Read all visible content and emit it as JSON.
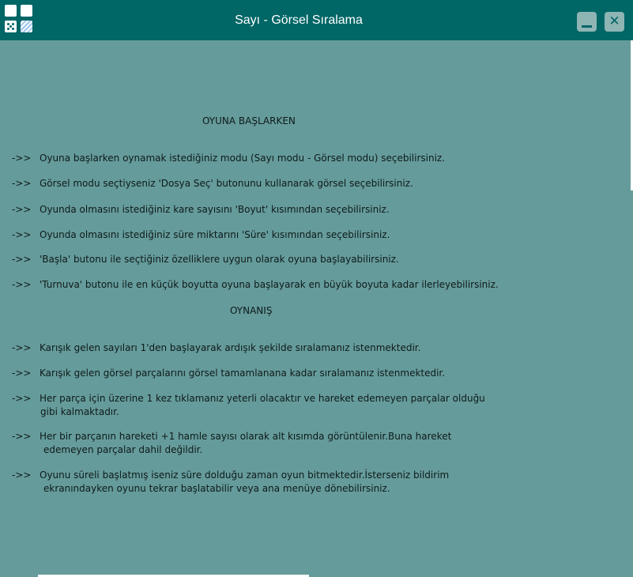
{
  "window": {
    "title": "Sayı - Görsel Sıralama",
    "icons": {
      "app": "grid-dice-icon",
      "minimize": "minimize-icon",
      "close": "close-icon"
    },
    "colors": {
      "titlebar": "#006666",
      "background": "#669b9b"
    }
  },
  "sections": [
    {
      "heading": "OYUNA BAŞLARKEN",
      "items": [
        {
          "arrow": "->>",
          "text": "Oyuna başlarken oynamak istediğiniz modu (Sayı modu - Görsel modu) seçebilirsiniz."
        },
        {
          "arrow": "->>",
          "text": "Görsel modu seçtiyseniz 'Dosya Seç' butonunu kullanarak görsel seçebilirsiniz."
        },
        {
          "arrow": "->>",
          "text": "Oyunda olmasını istediğiniz kare sayısını 'Boyut' kısımından seçebilirsiniz."
        },
        {
          "arrow": "->>",
          "text": "Oyunda olmasını istediğiniz süre miktarını 'Süre' kısımından seçebilirsiniz."
        },
        {
          "arrow": "->>",
          "text": "'Başla' butonu ile seçtiğiniz özelliklere uygun olarak oyuna başlayabilirsiniz."
        },
        {
          "arrow": "->>",
          "text": "'Turnuva' butonu ile en küçük boyutta oyuna başlayarak en büyük boyuta kadar ilerleyebilirsiniz."
        }
      ]
    },
    {
      "heading": "OYNANIŞ",
      "items": [
        {
          "arrow": "->>",
          "text": "Karışık gelen sayıları 1'den başlayarak ardışık şekilde sıralamanız istenmektedir."
        },
        {
          "arrow": "->>",
          "text": "Karışık gelen görsel parçalarını görsel tamamlanana kadar sıralamanız istenmektedir."
        },
        {
          "arrow": "->>",
          "text": "Her parça için üzerine 1 kez tıklamanız yeterli olacaktır ve hareket edemeyen parçalar olduğu",
          "cont": "gibi kalmaktadır."
        },
        {
          "arrow": "->>",
          "text": "Her bir parçanın hareketi +1 hamle sayısı olarak alt kısımda görüntülenir.Buna hareket",
          "cont": "edemeyen parçalar dahil değildir."
        },
        {
          "arrow": "->>",
          "text": "Oyunu süreli başlatmış iseniz süre dolduğu zaman oyun bitmektedir.İsterseniz bildirim",
          "cont": "ekranındayken oyunu tekrar başlatabilir veya ana menüye dönebilirsiniz."
        }
      ]
    }
  ]
}
